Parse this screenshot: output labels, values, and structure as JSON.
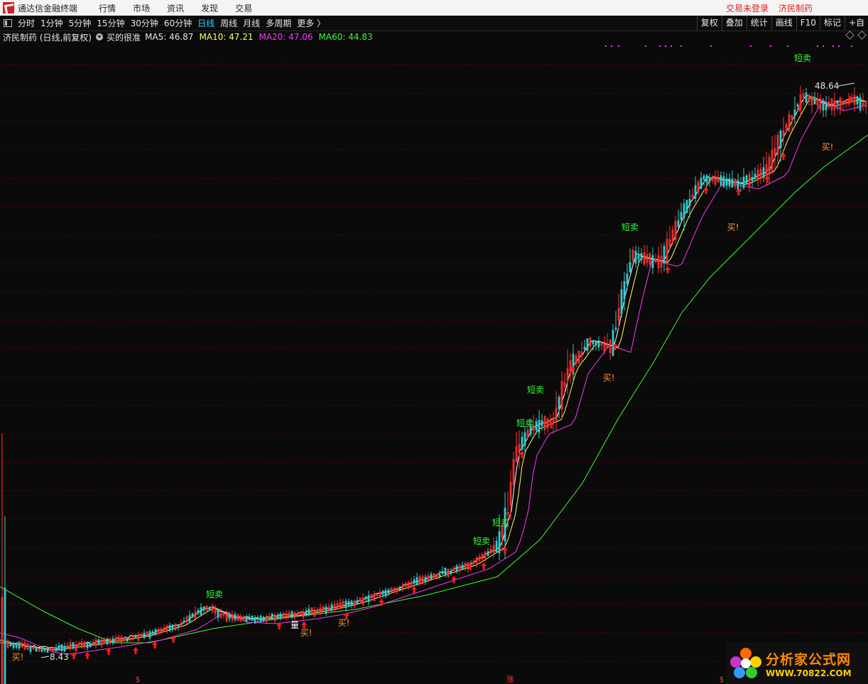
{
  "app": {
    "title": "通达信金融终端",
    "menus": [
      "行情",
      "市场",
      "资讯",
      "发现",
      "交易"
    ],
    "trade_status": "交易未登录",
    "stock_name": "济民制药"
  },
  "toolbar": {
    "periods": [
      "分时",
      "1分钟",
      "5分钟",
      "15分钟",
      "30分钟",
      "60分钟",
      "日线",
      "周线",
      "月线",
      "多周期",
      "更多 〉"
    ],
    "active_period": "日线",
    "right_tools": [
      "复权",
      "叠加",
      "统计",
      "画线",
      "F10",
      "标记",
      "+自"
    ]
  },
  "info": {
    "stock_label": "济民制药 (日线,前复权)",
    "formula": "买的很准",
    "ma5": "MA5: 46.87",
    "ma10": "MA10: 47.21",
    "ma20": "MA20: 47.06",
    "ma60": "MA60: 44.83"
  },
  "colors": {
    "background": "#0a0a0a",
    "grid": "#5a0000",
    "ma5": "#ffffff",
    "ma10": "#ffff66",
    "ma20": "#ff33ff",
    "ma60": "#33ff33",
    "up_candle": "#ff3333",
    "down_candle": "#33cccc",
    "sell_signal": "#33ff33",
    "buy_signal": "#ff9933",
    "arrow": "#ff1a1a"
  },
  "chart_data": {
    "type": "candlestick",
    "price_range": [
      8.43,
      48.64
    ],
    "annotations": {
      "high_label": "48.64",
      "low_label": "8.43",
      "sell_text": "短卖",
      "buy_text": "买!",
      "volume_text": "量",
      "bottom_marks": [
        "$",
        "涨",
        "$"
      ]
    }
  },
  "watermark": {
    "title": "分析家公式网",
    "url": "WWW.70822.COM"
  }
}
